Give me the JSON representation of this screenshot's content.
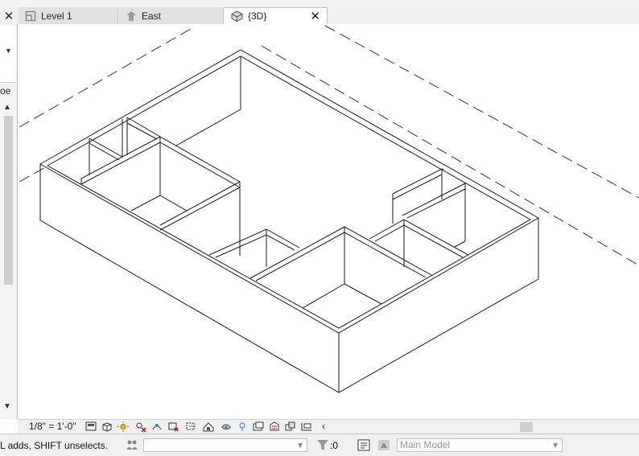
{
  "tabs": [
    {
      "label": "Level 1",
      "icon": "floor-plan-icon",
      "active": false
    },
    {
      "label": "East",
      "icon": "elevation-icon",
      "active": false
    },
    {
      "label": "{3D}",
      "icon": "3d-view-icon",
      "active": true
    }
  ],
  "left_panel": {
    "partial_label": "oe"
  },
  "view_controls": {
    "scale": "1/8\" = 1'-0\"",
    "icons": [
      "detail-level-icon",
      "visual-style-icon",
      "sun-path-icon",
      "shadows-icon",
      "rendering-icon",
      "crop-view-icon",
      "show-crop-region-icon",
      "unlock-3d-view-icon",
      "temporary-hide-icon",
      "reveal-hidden-icon",
      "worksharing-display-icon",
      "analytical-model-icon",
      "highlight-displacement-icon",
      "constraints-icon"
    ]
  },
  "status_bar": {
    "message": "L adds, SHIFT unselects.",
    "filter_count": ":0",
    "model_selector": "Main Model"
  }
}
